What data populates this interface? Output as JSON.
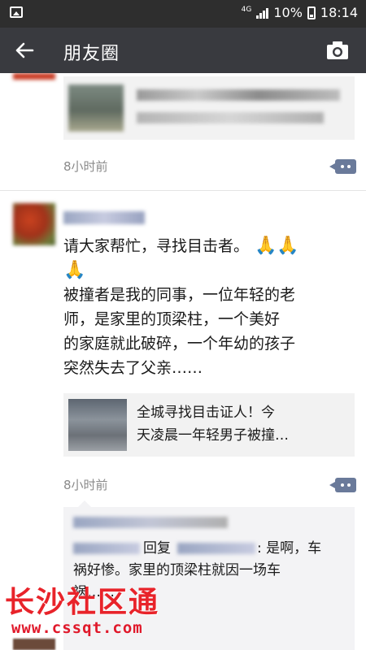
{
  "status_bar": {
    "network": "4G",
    "battery": "10%",
    "time": "18:14"
  },
  "header": {
    "title": "朋友圈",
    "back_icon": "back-arrow-icon",
    "camera_icon": "camera-icon"
  },
  "feed": {
    "post_1": {
      "timestamp": "8小时前"
    },
    "post_2": {
      "text_line_1": "请大家帮忙，寻找目击者。",
      "body_lines": [
        "被撞者是我的同事，一位年轻的老",
        "师，是家里的顶梁柱，一个美好",
        "的家庭就此破碎，一个年幼的孩子",
        "突然失去了父亲……"
      ],
      "link_title_lines": [
        "全城寻找目击证人！今",
        "天凌晨一年轻男子被撞…"
      ],
      "timestamp": "8小时前",
      "comment": {
        "reply_word": "回复",
        "text_after_name": ": 是啊，车",
        "line_2": "祸好惨。家里的顶梁柱就因一场车",
        "line_3": "祸……"
      }
    }
  },
  "watermark": {
    "title": "长沙社区通",
    "url": "www.cssqt.com"
  },
  "colors": {
    "status_bar": "#2e2e2e",
    "title_bar": "#393a3f",
    "link_name": "#576b95",
    "watermark": "#e8232a"
  }
}
